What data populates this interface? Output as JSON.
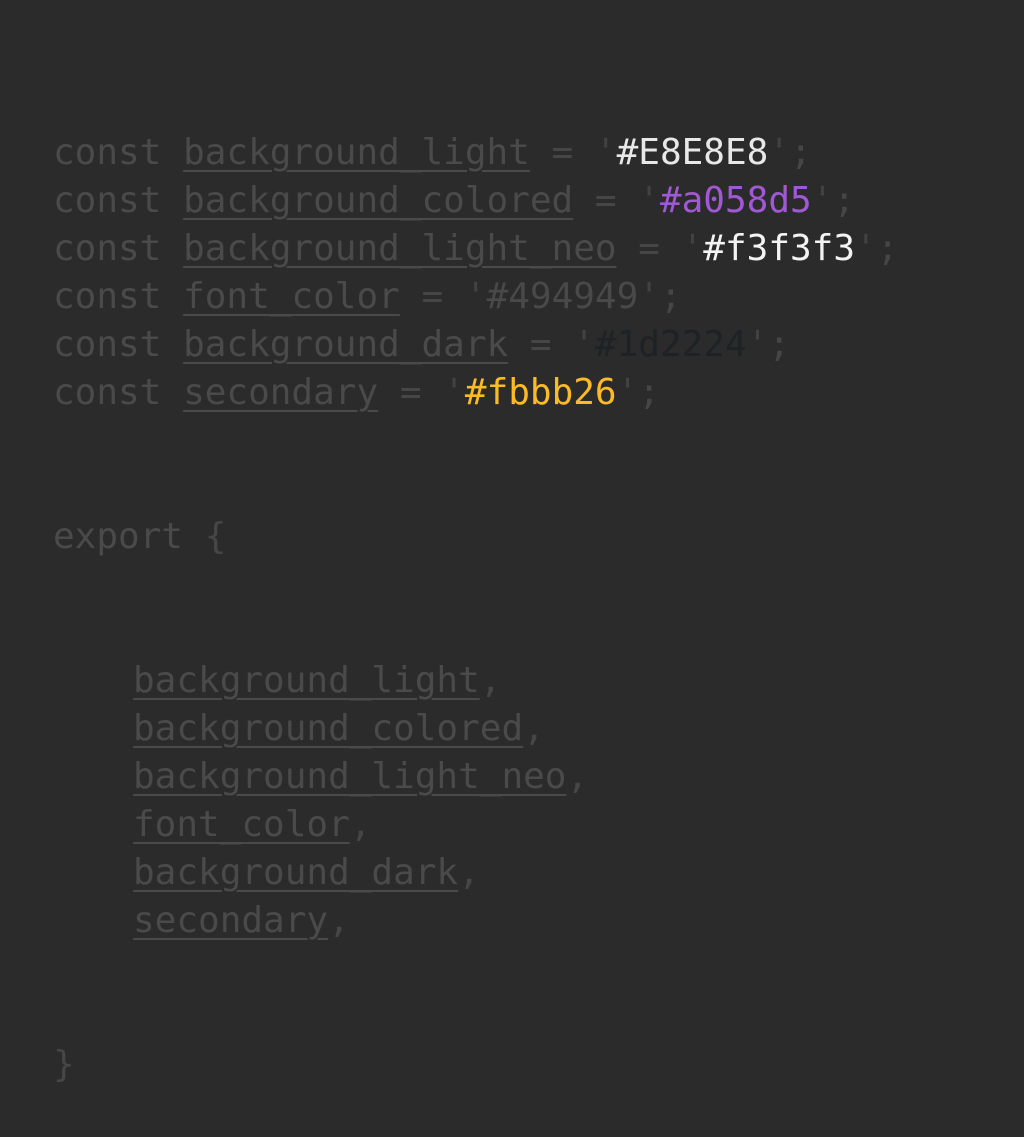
{
  "colors": {
    "background": "#2b2b2b",
    "dim_text": "#4a4a4a"
  },
  "code": {
    "declarations": [
      {
        "keyword": "const",
        "name": "background_light",
        "op": "=",
        "value": "#E8E8E8",
        "color": "#E8E8E8"
      },
      {
        "keyword": "const",
        "name": "background_colored",
        "op": "=",
        "value": "#a058d5",
        "color": "#a058d5"
      },
      {
        "keyword": "const",
        "name": "background_light_neo",
        "op": "=",
        "value": "#f3f3f3",
        "color": "#f3f3f3"
      },
      {
        "keyword": "const",
        "name": "font_color",
        "op": "=",
        "value": "#494949",
        "color": "#494949"
      },
      {
        "keyword": "const",
        "name": "background_dark",
        "op": "=",
        "value": "#1d2224",
        "color": "#1d2224"
      },
      {
        "keyword": "const",
        "name": "secondary",
        "op": "=",
        "value": "#fbbb26",
        "color": "#fbbb26"
      }
    ],
    "export_keyword": "export",
    "open_brace": "{",
    "close_brace": "}",
    "exports": [
      "background_light",
      "background_colored",
      "background_light_neo",
      "font_color",
      "background_dark",
      "secondary"
    ],
    "quote": "'",
    "semicolon": ";",
    "comma": ","
  }
}
